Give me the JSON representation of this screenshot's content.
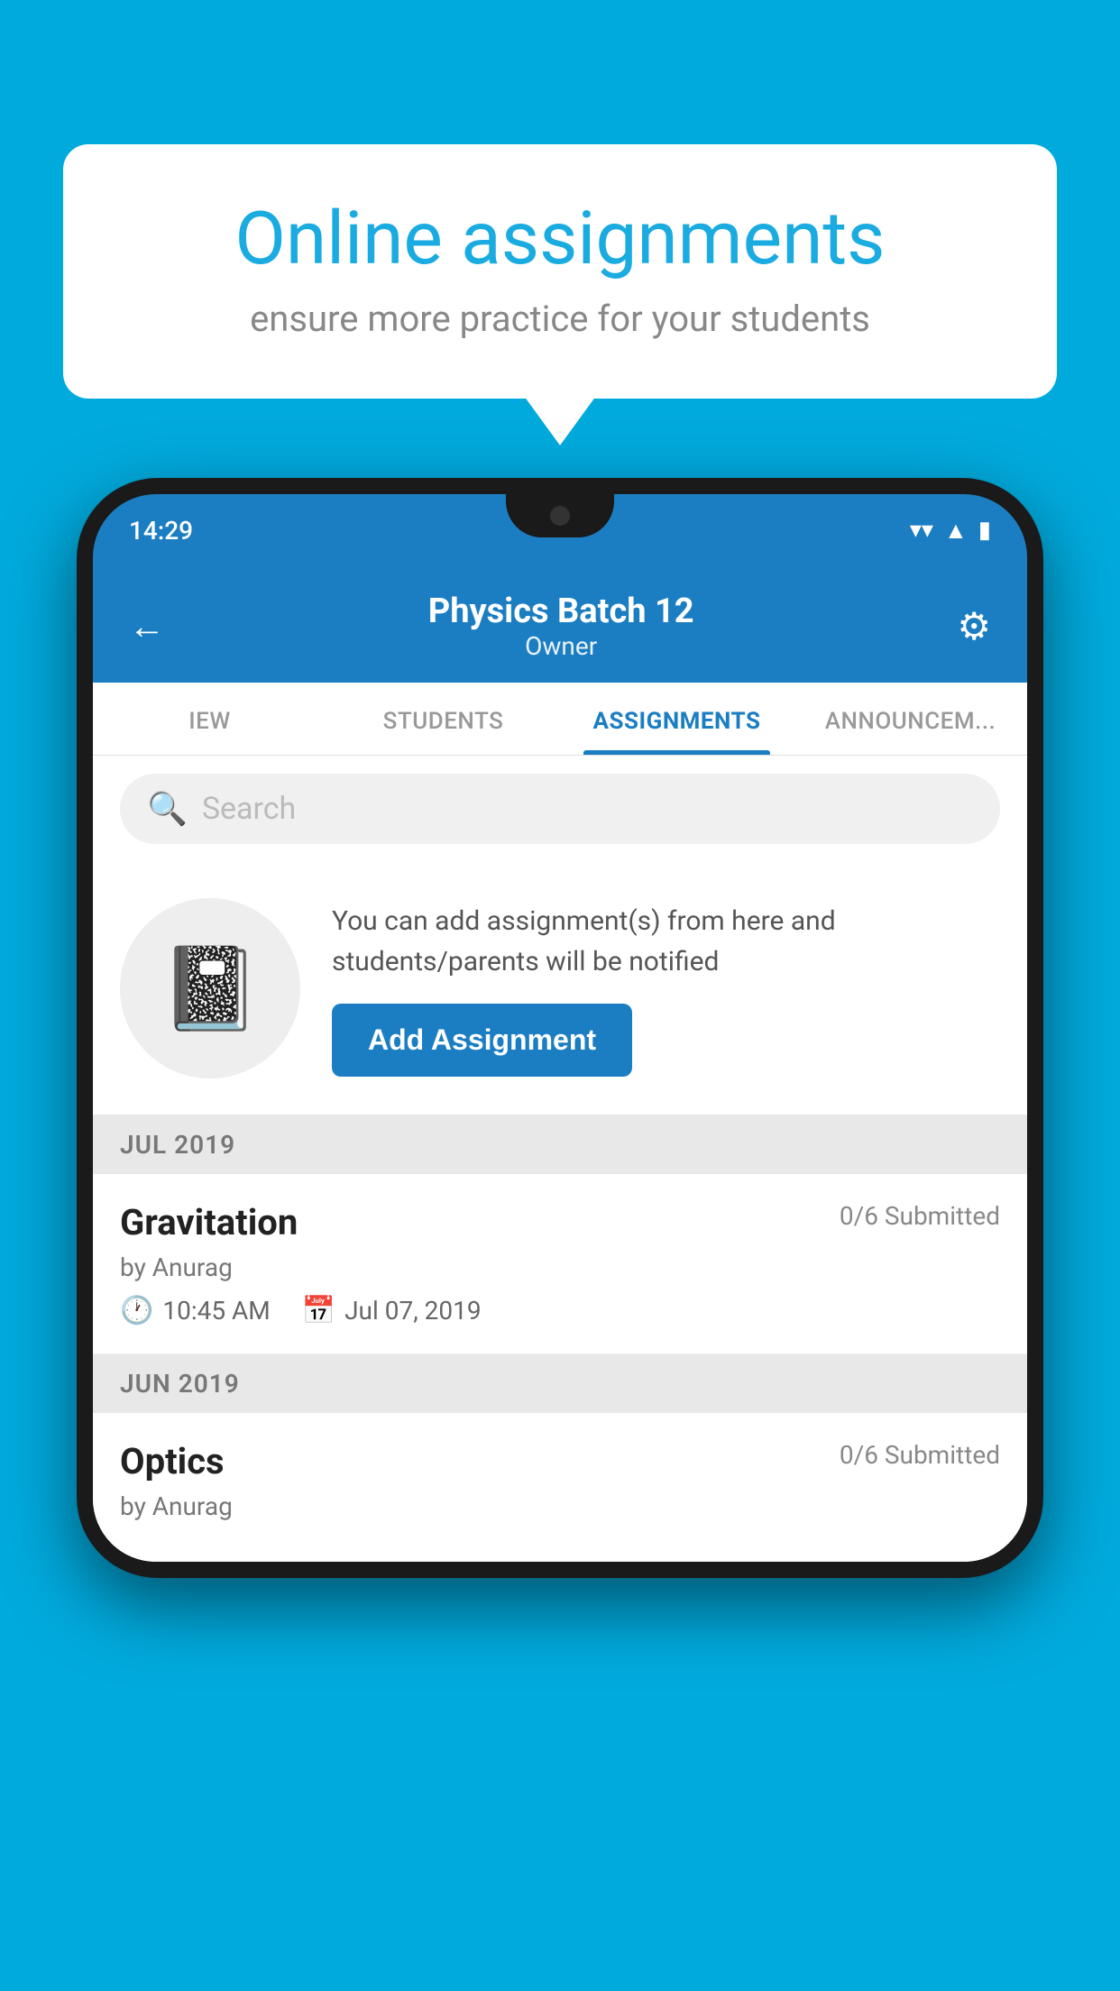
{
  "background_color": "#00AADD",
  "speech_bubble": {
    "title": "Online assignments",
    "subtitle": "ensure more practice for your students"
  },
  "phone": {
    "status_bar": {
      "time": "14:29",
      "icons": [
        "wifi",
        "signal",
        "battery"
      ]
    },
    "header": {
      "title": "Physics Batch 12",
      "subtitle": "Owner",
      "back_label": "←",
      "settings_label": "⚙"
    },
    "tabs": [
      {
        "label": "IEW",
        "active": false
      },
      {
        "label": "STUDENTS",
        "active": false
      },
      {
        "label": "ASSIGNMENTS",
        "active": true
      },
      {
        "label": "ANNOUNCEM...",
        "active": false
      }
    ],
    "search": {
      "placeholder": "Search"
    },
    "promo": {
      "text": "You can add assignment(s) from here and students/parents will be notified",
      "button_label": "Add Assignment"
    },
    "sections": [
      {
        "header": "JUL 2019",
        "assignments": [
          {
            "name": "Gravitation",
            "submitted": "0/6 Submitted",
            "by": "by Anurag",
            "time": "10:45 AM",
            "date": "Jul 07, 2019"
          }
        ]
      },
      {
        "header": "JUN 2019",
        "assignments": [
          {
            "name": "Optics",
            "submitted": "0/6 Submitted",
            "by": "by Anurag",
            "time": "",
            "date": ""
          }
        ]
      }
    ]
  }
}
